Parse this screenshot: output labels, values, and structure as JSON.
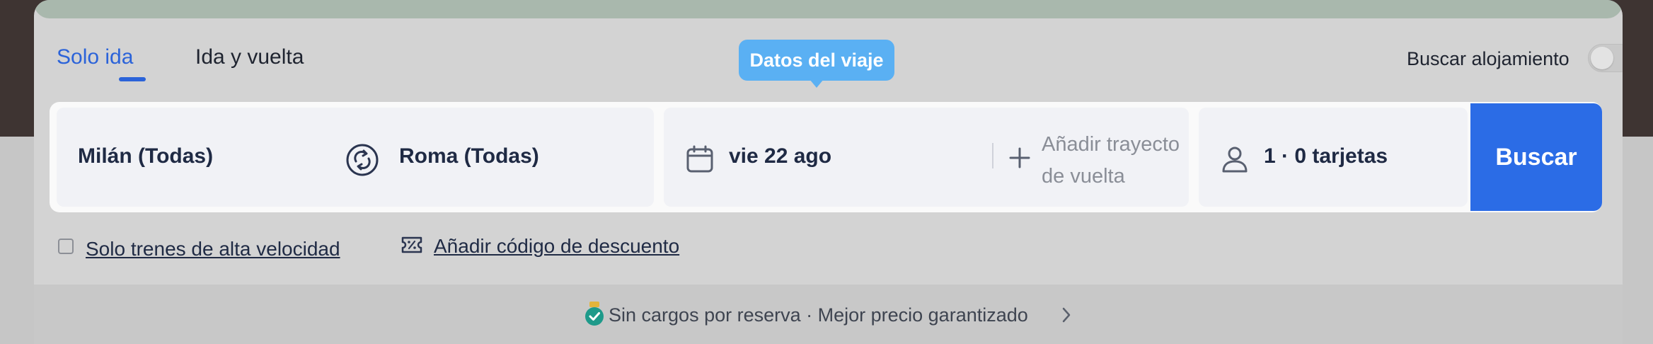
{
  "trip_types": {
    "one_way": "Solo ida",
    "round_trip": "Ida y vuelta"
  },
  "tooltip": "Datos del viaje",
  "accommodation": {
    "label": "Buscar alojamiento",
    "enabled": false
  },
  "search": {
    "origin": "Milán (Todas)",
    "destination": "Roma (Todas)",
    "departure_date": "vie 22 ago",
    "return_placeholder": "Añadir trayecto de vuelta",
    "passengers": "1 · 0 tarjetas",
    "button_label": "Buscar"
  },
  "options": {
    "high_speed_label": "Solo trenes de alta velocidad",
    "high_speed_checked": false,
    "discount_label": "Añadir código de descuento"
  },
  "footer": {
    "text": "Sin cargos por reserva · Mejor precio garantizado"
  },
  "icons": {
    "swap": "swap-icon",
    "calendar": "calendar-icon",
    "plus": "plus-icon",
    "passenger": "person-icon",
    "discount": "ticket-percent-icon",
    "guarantee": "verified-badge-icon",
    "chevron": "chevron-right-icon"
  },
  "colors": {
    "accent": "#2b63d9",
    "button": "#2b6ce6",
    "tooltip": "#5ab0f3",
    "text_dark": "#1f2a44"
  }
}
